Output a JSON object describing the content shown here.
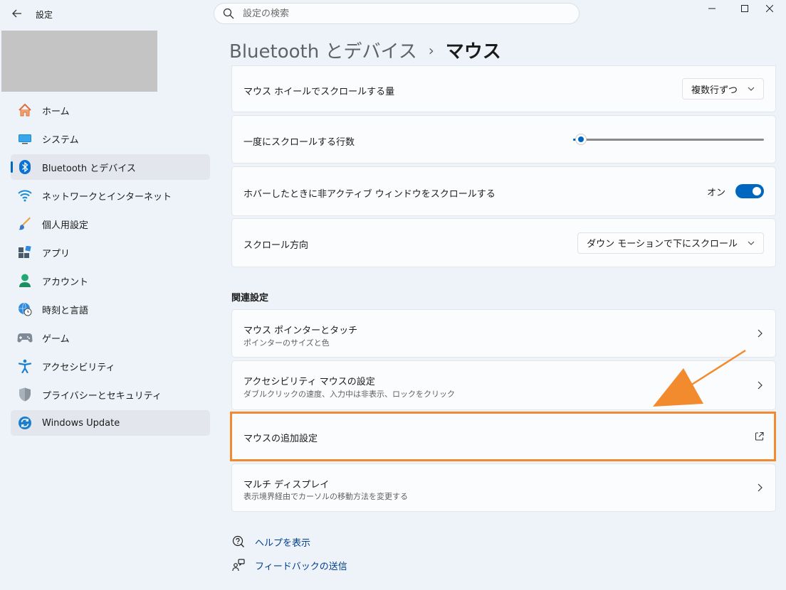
{
  "window": {
    "title": "設定",
    "controls": [
      "minimize",
      "maximize",
      "close"
    ]
  },
  "search": {
    "placeholder": "設定の検索"
  },
  "sidebar": {
    "items": [
      {
        "label": "ホーム",
        "icon": "home-icon"
      },
      {
        "label": "システム",
        "icon": "display-icon"
      },
      {
        "label": "Bluetooth とデバイス",
        "icon": "bluetooth-icon",
        "active": true
      },
      {
        "label": "ネットワークとインターネット",
        "icon": "wifi-icon"
      },
      {
        "label": "個人用設定",
        "icon": "brush-icon"
      },
      {
        "label": "アプリ",
        "icon": "apps-icon"
      },
      {
        "label": "アカウント",
        "icon": "person-icon"
      },
      {
        "label": "時刻と言語",
        "icon": "globe-clock-icon"
      },
      {
        "label": "ゲーム",
        "icon": "gamepad-icon"
      },
      {
        "label": "アクセシビリティ",
        "icon": "accessibility-icon"
      },
      {
        "label": "プライバシーとセキュリティ",
        "icon": "shield-icon"
      },
      {
        "label": "Windows Update",
        "icon": "update-icon",
        "hover": true
      }
    ]
  },
  "breadcrumb": {
    "parent": "Bluetooth とデバイス",
    "separator": "›",
    "current": "マウス"
  },
  "settings": {
    "wheel_amount": {
      "label": "マウス ホイールでスクロールする量",
      "value": "複数行ずつ"
    },
    "lines_per_scroll": {
      "label": "一度にスクロールする行数",
      "slider_fraction": 0.04
    },
    "hover_scroll": {
      "label": "ホバーしたときに非アクティブ ウィンドウをスクロールする",
      "state_label": "オン",
      "on": true
    },
    "scroll_direction": {
      "label": "スクロール方向",
      "value": "ダウン モーションで下にスクロール"
    }
  },
  "related": {
    "title": "関連設定",
    "items": [
      {
        "label": "マウス ポインターとタッチ",
        "sub": "ポインターのサイズと色",
        "action": "chevron"
      },
      {
        "label": "アクセシビリティ マウスの設定",
        "sub": "ダブルクリックの速度、入力中は非表示、ロックをクリック",
        "action": "chevron"
      },
      {
        "label": "マウスの追加設定",
        "sub": "",
        "action": "external"
      },
      {
        "label": "マルチ ディスプレイ",
        "sub": "表示境界経由でカーソルの移動方法を変更する",
        "action": "chevron"
      }
    ]
  },
  "footer": {
    "help": "ヘルプを表示",
    "feedback": "フィードバックの送信"
  },
  "colors": {
    "accent": "#0067c0",
    "highlight": "#f28a2e"
  }
}
